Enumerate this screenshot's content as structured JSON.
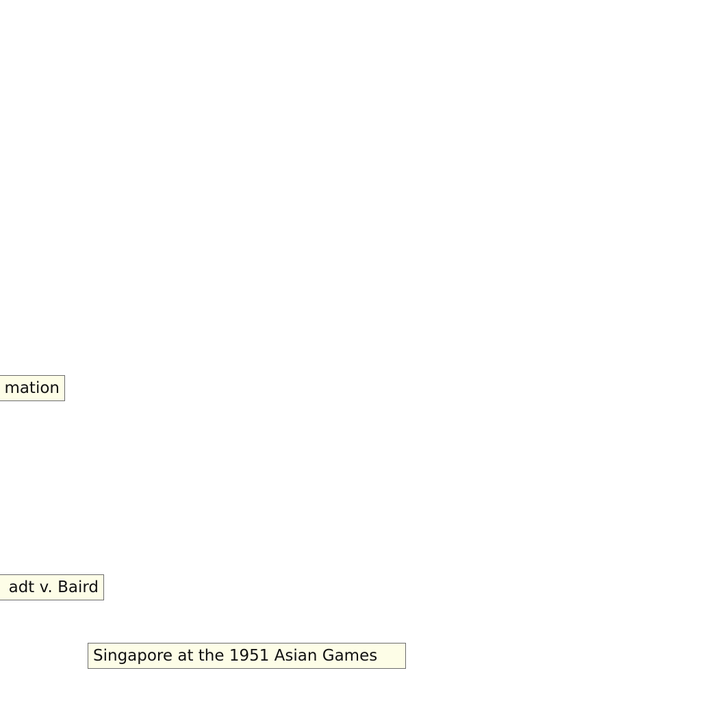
{
  "tooltips": {
    "first": "mation",
    "second": "adt v. Baird",
    "third": "Singapore at the 1951 Asian Games"
  }
}
